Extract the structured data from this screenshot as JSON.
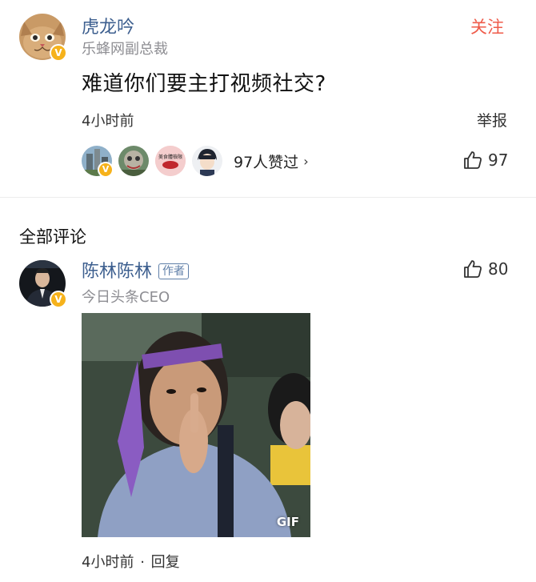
{
  "post": {
    "author": {
      "name": "虎龙吟",
      "title": "乐蜂网副总裁",
      "verified_badge": "V"
    },
    "follow_label": "关注",
    "content": "难道你们要主打视频社交?",
    "time": "4小时前",
    "report_label": "举报",
    "likers": {
      "count_label": "97人赞过",
      "chevron": "›",
      "liker_3_text": "美食體檢限"
    },
    "like_count": "97"
  },
  "comments": {
    "section_title": "全部评论",
    "items": [
      {
        "author": "陈林陈林",
        "author_tag": "作者",
        "title": "今日头条CEO",
        "verified_badge": "V",
        "like_count": "80",
        "media_badge": "GIF",
        "time": "4小时前",
        "separator": "·",
        "reply_label": "回复"
      }
    ]
  },
  "colors": {
    "link_blue": "#3d5f8f",
    "follow_red": "#ef5b4a",
    "badge_gold": "#f6b21b",
    "meta_gray": "#8e8e93"
  },
  "icons": [
    "cat-avatar",
    "verified-badge-icon",
    "thumb-up-icon",
    "chevron-right-icon",
    "person-avatar"
  ]
}
